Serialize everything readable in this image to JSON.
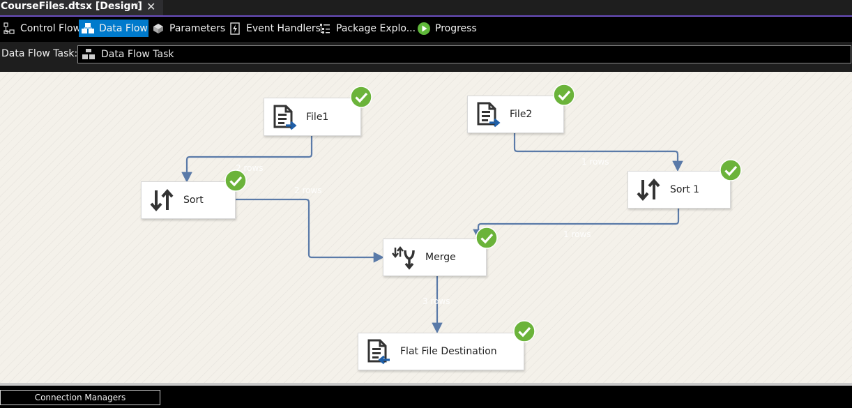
{
  "document_tab": {
    "title": "CourseFiles.dtsx [Design]",
    "pin_glyph": "⊣",
    "close_glyph": "✕"
  },
  "designer_tabs": [
    {
      "label": "Control Flow",
      "icon": "control-flow-icon",
      "active": false
    },
    {
      "label": "Data Flow",
      "icon": "data-flow-icon",
      "active": true
    },
    {
      "label": "Parameters",
      "icon": "parameters-icon",
      "active": false
    },
    {
      "label": "Event Handlers",
      "icon": "event-handlers-icon",
      "active": false
    },
    {
      "label": "Package Explo...",
      "icon": "package-explorer-icon",
      "active": false
    },
    {
      "label": "Progress",
      "icon": "progress-icon",
      "active": false
    }
  ],
  "task_bar": {
    "label": "Data Flow Task:",
    "selected": "Data Flow Task"
  },
  "components": {
    "file1": {
      "label": "File1",
      "icon": "flat-file-source-icon",
      "status": "success"
    },
    "file2": {
      "label": "File2",
      "icon": "flat-file-source-icon",
      "status": "success"
    },
    "sort": {
      "label": "Sort",
      "icon": "sort-icon",
      "status": "success"
    },
    "sort1": {
      "label": "Sort 1",
      "icon": "sort-icon",
      "status": "success"
    },
    "merge": {
      "label": "Merge",
      "icon": "merge-icon",
      "status": "success"
    },
    "dest": {
      "label": "Flat File Destination",
      "icon": "flat-file-destination-icon",
      "status": "success"
    }
  },
  "paths": {
    "file1_sort": "2 rows",
    "file2_sort1": "1 rows",
    "sort_merge": "2 rows",
    "sort1_merge": "1 rows",
    "merge_dest": "3 rows"
  },
  "bottom": {
    "connection_managers": "Connection Managers"
  },
  "colors": {
    "accent": "#007acc",
    "path": "#5a7aa8",
    "success": "#6bb33a",
    "purple": "#6c4fc0"
  }
}
